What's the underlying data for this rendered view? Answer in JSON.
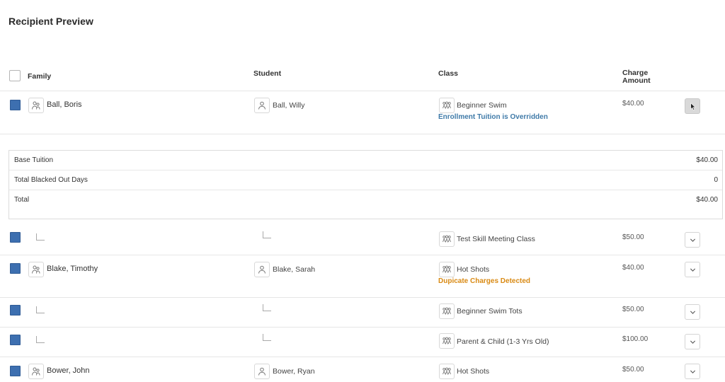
{
  "page": {
    "title": "Recipient Preview"
  },
  "columns": {
    "family": "Family",
    "student": "Student",
    "class": "Class",
    "charge": "Charge Amount"
  },
  "rows": [
    {
      "family": "Ball, Boris",
      "student": "Ball, Willy",
      "class": "Beginner Swim",
      "amount": "$40.00",
      "note": "Enrollment Tuition is Overridden",
      "note_type": "info",
      "expanded": true,
      "checked": true
    },
    {
      "family": "",
      "student": "",
      "class": "Test Skill Meeting Class",
      "amount": "$50.00",
      "note": "",
      "expanded": false,
      "checked": true
    },
    {
      "family": "Blake, Timothy",
      "student": "Blake, Sarah",
      "class": "Hot Shots",
      "amount": "$40.00",
      "note": "Dupicate Charges Detected",
      "note_type": "warning",
      "expanded": false,
      "checked": true
    },
    {
      "family": "",
      "student": "",
      "class": "Beginner Swim Tots",
      "amount": "$50.00",
      "note": "",
      "expanded": false,
      "checked": true
    },
    {
      "family": "",
      "student": "",
      "class": "Parent & Child (1-3 Yrs Old)",
      "amount": "$100.00",
      "note": "",
      "expanded": false,
      "checked": true
    },
    {
      "family": "Bower, John",
      "student": "Bower, Ryan",
      "class": "Hot Shots",
      "amount": "$50.00",
      "note": "",
      "expanded": false,
      "checked": true
    }
  ],
  "breakdown": [
    {
      "label": "Base Tuition",
      "value": "$40.00"
    },
    {
      "label": "Total Blacked Out Days",
      "value": "0"
    },
    {
      "label": "Total",
      "value": "$40.00"
    }
  ],
  "icons": {
    "family": "family-icon",
    "student": "person-icon",
    "class": "group-icon",
    "expand": "chevron-down-icon",
    "collapse": "cursor-arrow-icon"
  },
  "colors": {
    "checkbox": "#3d6fb0",
    "info_note": "#3f7aa8",
    "warning_note": "#d98a14"
  }
}
